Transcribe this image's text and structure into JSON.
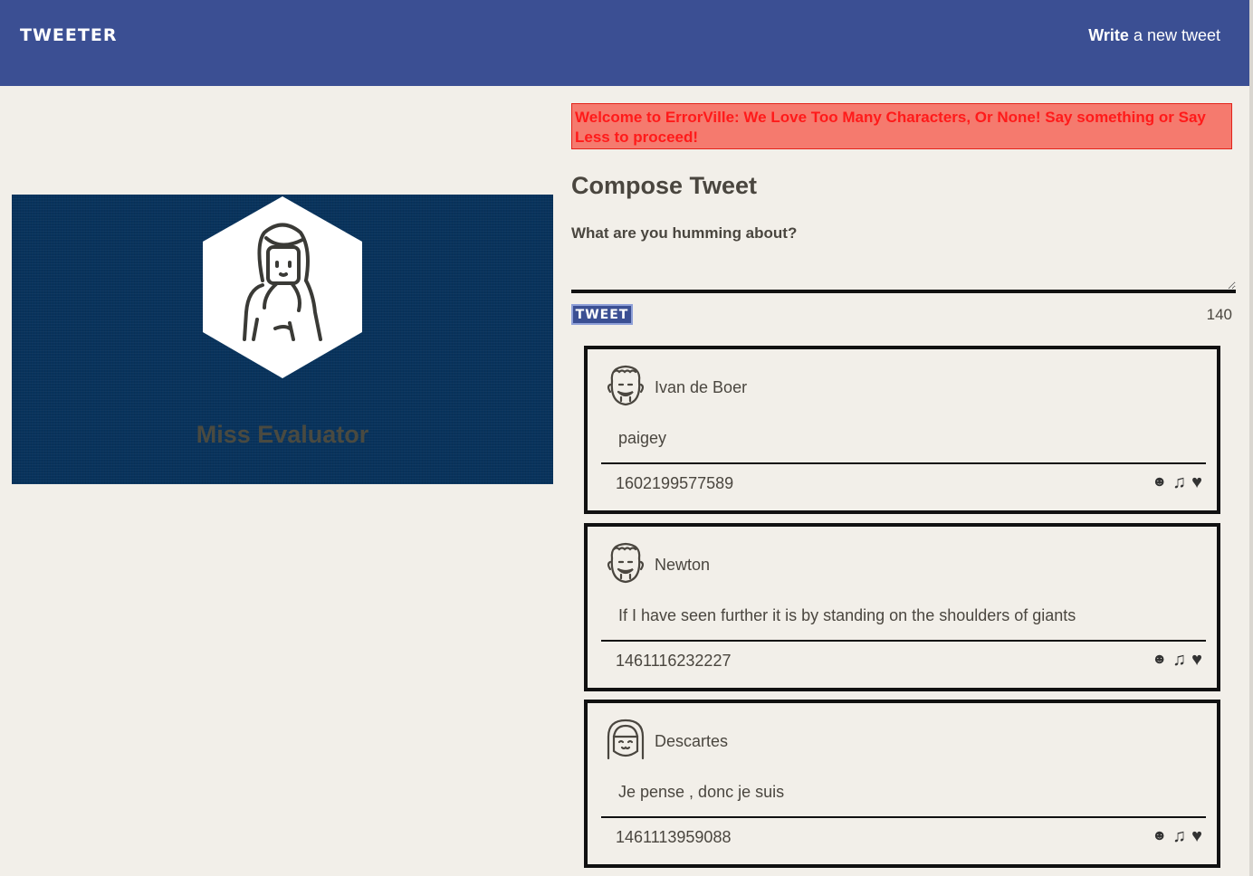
{
  "nav": {
    "brand": "TWEETER",
    "write_bold": "Write",
    "write_rest": " a new tweet"
  },
  "profile": {
    "name": "Miss Evaluator"
  },
  "compose": {
    "error": "Welcome to ErrorVille: We Love Too Many Characters, Or None! Say something or Say Less to proceed!",
    "title": "Compose Tweet",
    "label": "What are you humming about?",
    "input_value": "",
    "button": "TWEET",
    "counter": "140"
  },
  "tweets": [
    {
      "author": "Ivan de Boer",
      "content": "paigey",
      "timestamp": "1602199577589"
    },
    {
      "author": "Newton",
      "content": "If I have seen further it is by standing on the shoulders of giants",
      "timestamp": "1461116232227"
    },
    {
      "author": "Descartes",
      "content": "Je pense , donc je suis",
      "timestamp": "1461113959088"
    }
  ],
  "icons": {
    "flag": "☻",
    "retweet": "♫",
    "like": "♥"
  },
  "colors": {
    "nav": "#3b4f93",
    "background": "#f2efe9",
    "profile": "#08335c",
    "error_bg": "#f57a6e",
    "error_text": "#ff1a1a"
  }
}
